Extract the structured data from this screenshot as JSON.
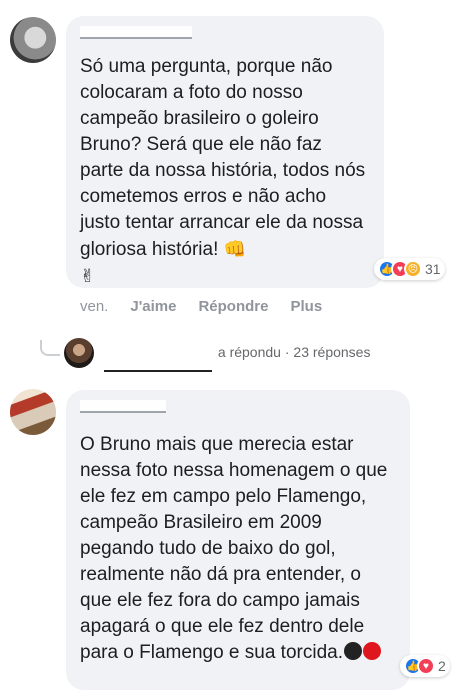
{
  "comment1": {
    "author": "",
    "text": "Só uma pergunta, porque não colocaram a foto do nosso campeão brasileiro o goleiro Bruno? Será que ele não faz parte da nossa história, todos nós cometemos erros e não acho justo tentar arrancar ele da nossa gloriosa história!",
    "emoji_fist": "👊",
    "emoji_victory": "✌",
    "reactions": {
      "icons": [
        "like-icon",
        "love-icon",
        "angry-icon"
      ],
      "count": "31"
    },
    "actions": {
      "time": "ven.",
      "like": "J'aime",
      "reply": "Répondre",
      "more": "Plus"
    }
  },
  "reply_summary": {
    "name": "",
    "replied": "a répondu",
    "separator": "·",
    "replies": "23 réponses"
  },
  "comment2": {
    "author": "",
    "text": "O Bruno mais que merecia estar nessa foto nessa homenagem o que ele fez em campo pelo Flamengo, campeão Brasileiro em 2009 pegando tudo de baixo do gol, realmente não dá pra entender, o que ele fez fora do campo jamais apagará o que ele fez dentro dele para o Flamengo e sua torcida.",
    "colors": {
      "black_dot": "#222222",
      "red_dot": "#e0161e"
    },
    "reactions": {
      "icons": [
        "like-icon",
        "love-icon"
      ],
      "count": "2"
    }
  },
  "colors": {
    "bubble": "#f0f2f5",
    "like": "#1877f2",
    "love": "#f33e58",
    "angry": "#f7b125"
  }
}
